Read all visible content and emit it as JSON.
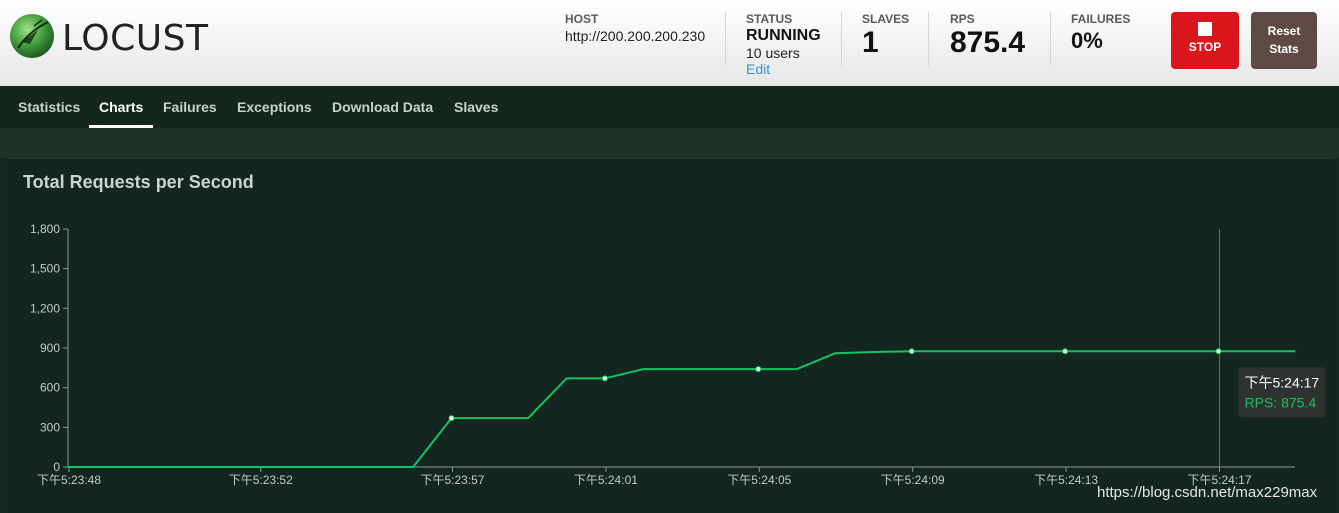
{
  "app": {
    "name": "LOCUST"
  },
  "header": {
    "host_label": "HOST",
    "host_value": "http://200.200.200.230",
    "status_label": "STATUS",
    "status_value": "RUNNING",
    "users_value": "10 users",
    "edit_label": "Edit",
    "slaves_label": "SLAVES",
    "slaves_value": "1",
    "rps_label": "RPS",
    "rps_value": "875.4",
    "failures_label": "FAILURES",
    "failures_value": "0%",
    "stop_label": "STOP",
    "reset_label_line1": "Reset",
    "reset_label_line2": "Stats"
  },
  "tabs": [
    "Statistics",
    "Charts",
    "Failures",
    "Exceptions",
    "Download Data",
    "Slaves"
  ],
  "active_tab": "Charts",
  "panel": {
    "title": "Total Requests per Second"
  },
  "tooltip": {
    "time": "下午5:24:17",
    "value": "RPS: 875.4"
  },
  "watermark": "https://blog.csdn.net/max229max",
  "colors": {
    "line": "#16c45e",
    "stop_button": "#d9161b",
    "reset_button": "#5f4a48",
    "link": "#3e8ed0"
  },
  "chart_data": {
    "type": "line",
    "x": [
      "5:23:47",
      "5:23:48",
      "5:23:49",
      "5:23:50",
      "5:23:51",
      "5:23:52",
      "5:23:53",
      "5:23:54",
      "5:23:55",
      "5:23:56",
      "5:23:57",
      "5:23:58",
      "5:23:59",
      "5:24:00",
      "5:24:01",
      "5:24:02",
      "5:24:03",
      "5:24:04",
      "5:24:05",
      "5:24:06",
      "5:24:07",
      "5:24:08",
      "5:24:09",
      "5:24:10",
      "5:24:11",
      "5:24:12",
      "5:24:13",
      "5:24:14",
      "5:24:15",
      "5:24:16",
      "5:24:17",
      "5:24:18",
      "5:24:19"
    ],
    "series": [
      {
        "name": "RPS",
        "values": [
          0,
          0,
          0,
          0,
          0,
          0,
          0,
          0,
          0,
          0,
          370,
          370,
          370,
          670,
          670,
          740,
          740,
          740,
          740,
          740,
          860,
          870,
          875,
          875,
          875,
          875,
          875,
          875,
          875,
          875,
          875,
          875,
          875
        ]
      }
    ],
    "markers": [
      10,
      14,
      18,
      22,
      26,
      30
    ],
    "yticks": [
      "0",
      "300",
      "600",
      "900",
      "1,200",
      "1,500",
      "1,800"
    ],
    "ylim": [
      0,
      1800
    ],
    "xtick_labels": [
      {
        "index": 0,
        "label": "下午5:23:48"
      },
      {
        "index": 5,
        "label": "下午5:23:52"
      },
      {
        "index": 10,
        "label": "下午5:23:57"
      },
      {
        "index": 14,
        "label": "下午5:24:01"
      },
      {
        "index": 18,
        "label": "下午5:24:05"
      },
      {
        "index": 22,
        "label": "下午5:24:09"
      },
      {
        "index": 26,
        "label": "下午5:24:13"
      },
      {
        "index": 30,
        "label": "下午5:24:17"
      }
    ],
    "hover_index": 30
  }
}
